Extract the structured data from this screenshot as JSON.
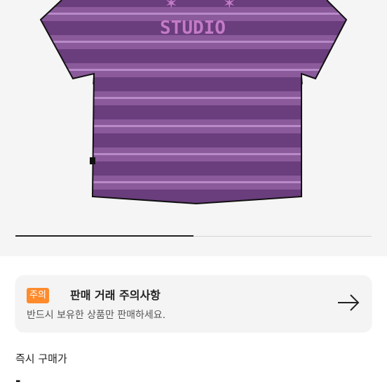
{
  "product": {
    "image_icon": "striped-tshirt",
    "print_text": "STUDIO",
    "colors": {
      "stripe_dark": "#6a3d7d",
      "stripe_mid": "#8a5a9b",
      "stripe_line": "#b98ac8"
    },
    "carousel_progress": 0.5
  },
  "notice": {
    "badge": "주의",
    "title": "판매 거래 주의사항",
    "description": "반드시 보유한 상품만 판매하세요.",
    "arrow_icon": "arrow-right-icon",
    "badge_color": "#ff8b2c"
  },
  "price": {
    "label": "즉시 구매가",
    "value": "-"
  }
}
